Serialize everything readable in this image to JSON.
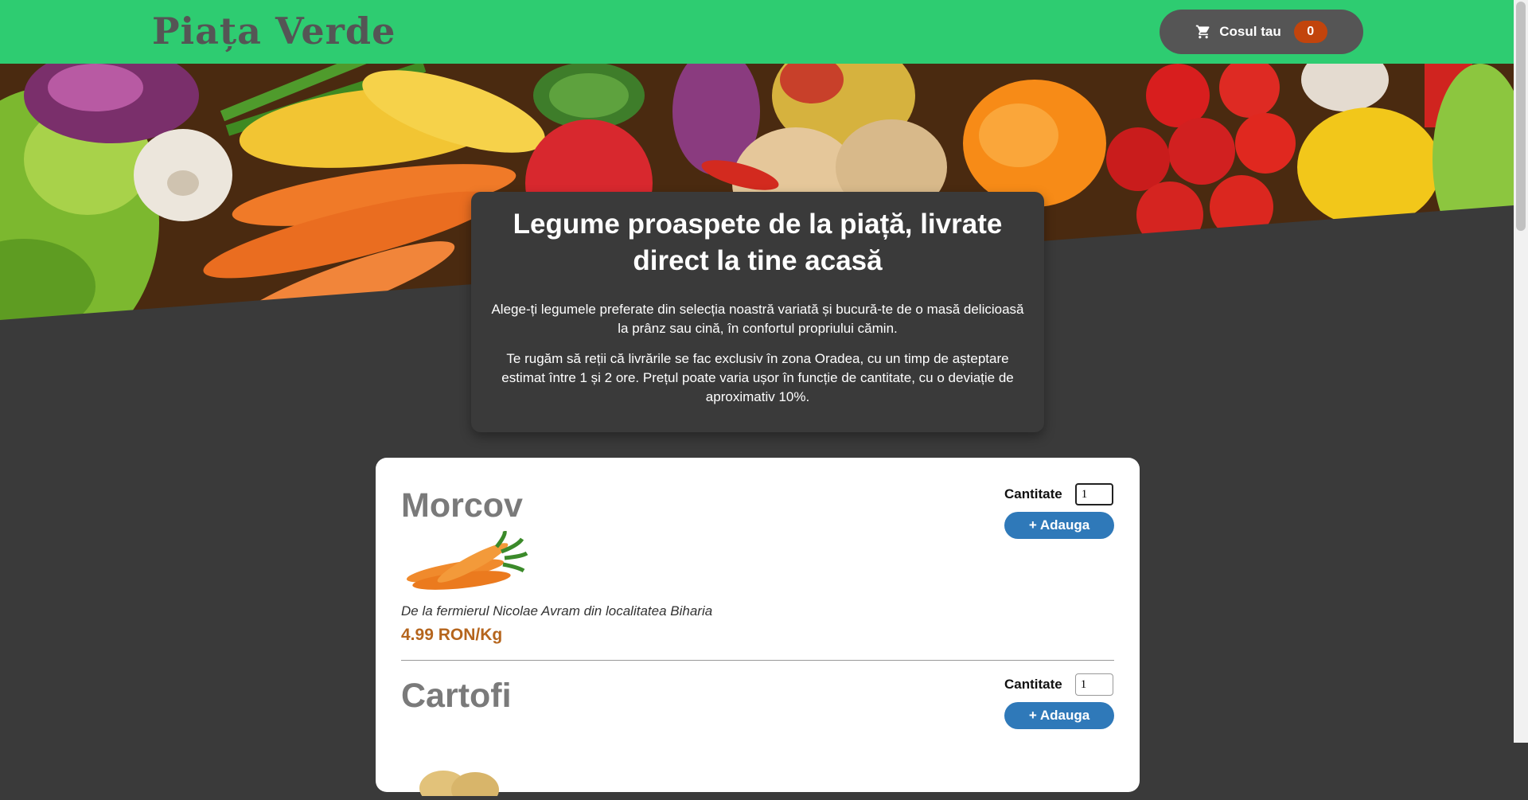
{
  "header": {
    "logo": "Piața Verde",
    "cart_label": "Cosul tau",
    "cart_count": "0",
    "cart_icon": "shopping-cart-icon"
  },
  "hero": {
    "image": "vegetables-banner"
  },
  "intro": {
    "title": "Legume proaspete de la piață, livrate direct la tine acasă",
    "paragraph1": "Alege-ți legumele preferate din selecția noastră variată și bucură-te de o masă delicioasă la prânz sau cină, în confortul propriului cămin.",
    "paragraph2": "Te rugăm să reții că livrările se fac exclusiv în zona Oradea, cu un timp de așteptare estimat între 1 și 2 ore. Prețul poate varia ușor în funcție de cantitate, cu o deviație de aproximativ 10%."
  },
  "products": [
    {
      "name": "Morcov",
      "origin": "De la fermierul Nicolae Avram din localitatea Biharia",
      "price": "4.99 RON/Kg",
      "qty_label": "Cantitate",
      "qty_value": "1",
      "add_label": "+ Adauga"
    },
    {
      "name": "Cartofi",
      "qty_label": "Cantitate",
      "qty_value": "1",
      "add_label": "+ Adauga"
    }
  ],
  "colors": {
    "header_bg": "#2ecc71",
    "page_bg": "#3a3a3a",
    "cart_badge": "#c2440c",
    "button": "#2f79b9",
    "price": "#b5651d"
  }
}
